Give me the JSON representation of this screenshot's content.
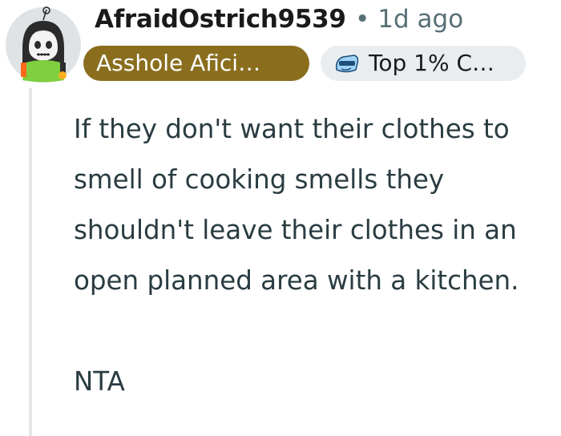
{
  "comment": {
    "author": "AfraidOstrich9539",
    "age": "1d ago",
    "user_flair": "Asshole Afici…",
    "achievement_badge": "Top 1% C…",
    "achievement_icon": "contributor-sunglasses-icon",
    "paragraph_1": "If they don't want their clothes to smell of cooking smells they shouldn't leave their clothes in an open planned area with a kitchen.",
    "paragraph_2": "NTA"
  },
  "colors": {
    "flair_bg": "#8a6e1e",
    "badge_bg": "#eaedef",
    "meta_text": "#576f76",
    "body_text": "#2a3c42"
  }
}
